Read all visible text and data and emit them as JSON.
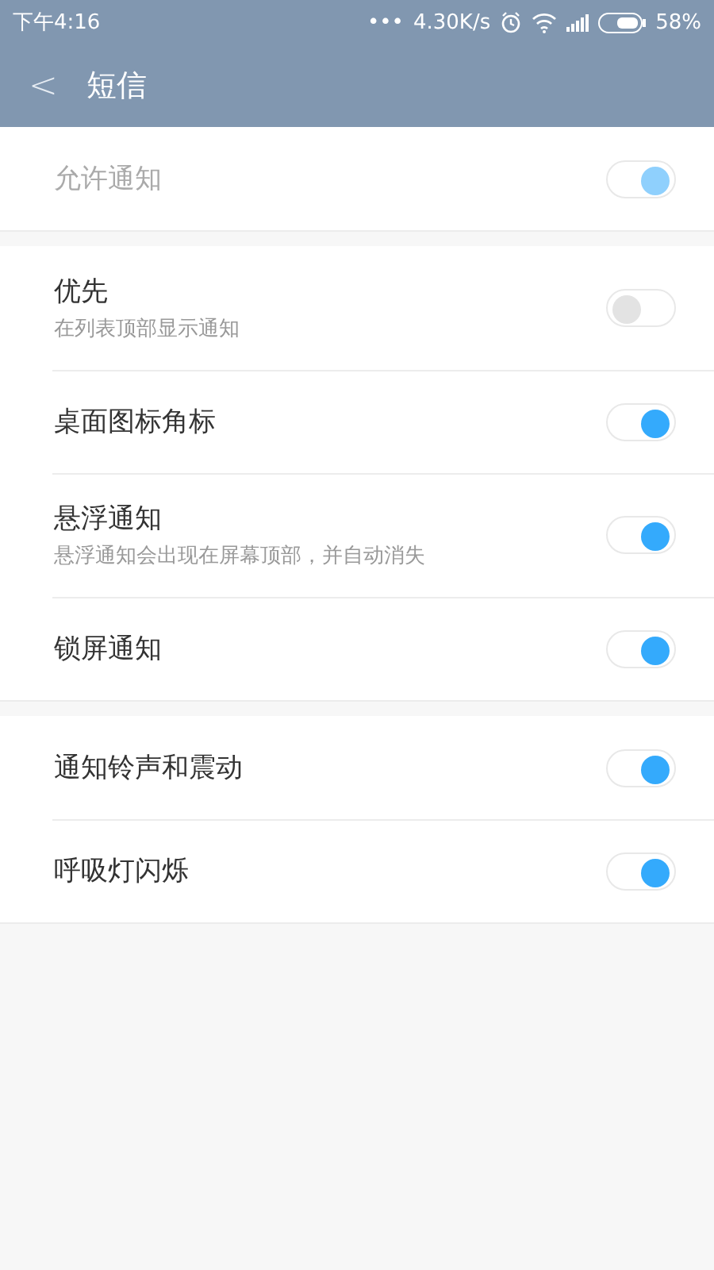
{
  "status_bar": {
    "time": "下午4:16",
    "dots": "•••",
    "speed": "4.30K/s",
    "battery": "58%"
  },
  "title_bar": {
    "back": "<",
    "title": "短信"
  },
  "groups": [
    {
      "items": [
        {
          "label": "允许通知",
          "on": true,
          "disabled": true
        }
      ]
    },
    {
      "items": [
        {
          "label": "优先",
          "subtitle": "在列表顶部显示通知",
          "on": false,
          "disabled": false
        },
        {
          "label": "桌面图标角标",
          "on": true,
          "disabled": false
        },
        {
          "label": "悬浮通知",
          "subtitle": "悬浮通知会出现在屏幕顶部，并自动消失",
          "on": true,
          "disabled": false
        },
        {
          "label": "锁屏通知",
          "on": true,
          "disabled": false
        }
      ]
    },
    {
      "items": [
        {
          "label": "通知铃声和震动",
          "on": true,
          "disabled": false
        },
        {
          "label": "呼吸灯闪烁",
          "on": true,
          "disabled": false
        }
      ]
    }
  ]
}
